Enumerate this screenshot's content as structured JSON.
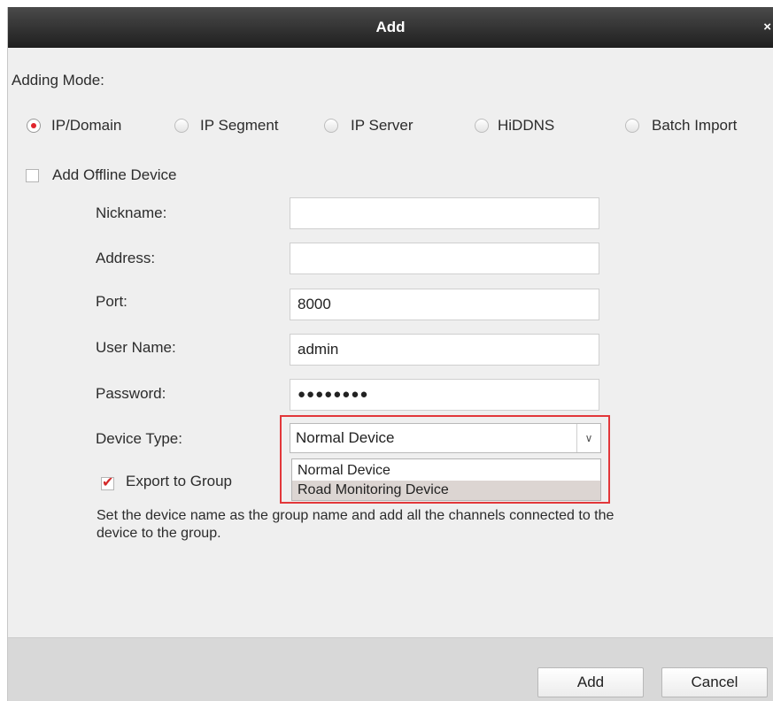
{
  "window": {
    "title": "Add",
    "close_glyph": "×"
  },
  "adding_mode": {
    "label": "Adding Mode:",
    "options": [
      {
        "label": "IP/Domain",
        "selected": true
      },
      {
        "label": "IP Segment",
        "selected": false
      },
      {
        "label": "IP Server",
        "selected": false
      },
      {
        "label": "HiDDNS",
        "selected": false
      },
      {
        "label": "Batch Import",
        "selected": false
      }
    ]
  },
  "offline_device": {
    "label": "Add Offline Device",
    "checked": false
  },
  "form": {
    "nickname": {
      "label": "Nickname:",
      "value": ""
    },
    "address": {
      "label": "Address:",
      "value": ""
    },
    "port": {
      "label": "Port:",
      "value": "8000"
    },
    "user_name": {
      "label": "User Name:",
      "value": "admin"
    },
    "password": {
      "label": "Password:",
      "value": "●●●●●●●●"
    },
    "device_type": {
      "label": "Device Type:",
      "value": "Normal Device",
      "options": [
        "Normal Device",
        "Road Monitoring Device"
      ],
      "hovered_option": "Road Monitoring Device"
    }
  },
  "export_group": {
    "label": "Export to Group",
    "checked": true,
    "check_glyph": "✔",
    "note": "Set the device name as the group name and add all the channels connected to the device to the group."
  },
  "buttons": {
    "add": "Add",
    "cancel": "Cancel"
  },
  "colors": {
    "accent_red": "#e0242c",
    "title_bar": "#2a2a2a",
    "footer": "#d8d8d8"
  }
}
